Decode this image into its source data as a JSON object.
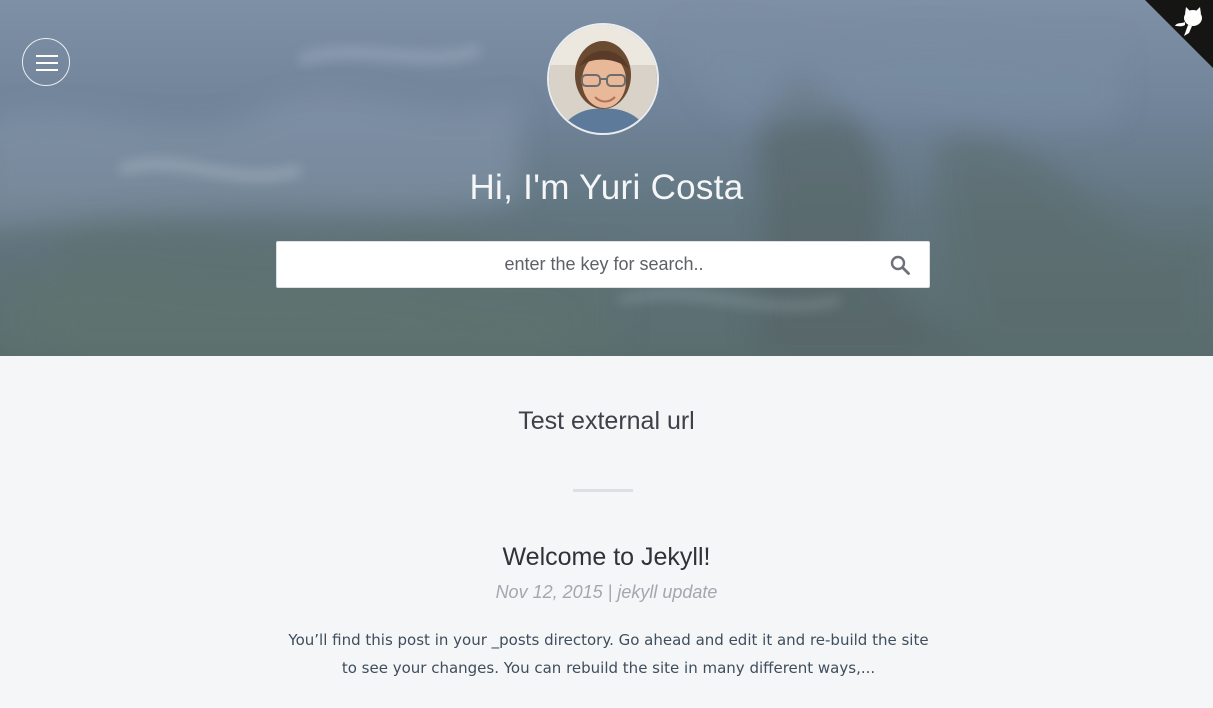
{
  "header": {
    "title": "Hi, I'm Yuri Costa",
    "search": {
      "placeholder": "enter the key for search..",
      "value": ""
    }
  },
  "icons": {
    "menu": "hamburger-menu-icon",
    "search": "search-icon",
    "corner": "github-octocat-icon",
    "avatar": "profile-photo"
  },
  "main": {
    "section_title": "Test external url",
    "posts": [
      {
        "title": "Welcome to Jekyll!",
        "date": "Nov 12, 2015",
        "separator": "|",
        "category": "jekyll update",
        "excerpt": "You’ll find this post in your _posts directory. Go ahead and edit it and re-build the site to see your changes. You can rebuild the site in many different ways,..."
      }
    ]
  },
  "colors": {
    "hero_top": "#7e90a6",
    "hero_bottom": "#5a6d6e",
    "page_bg": "#f5f6f8",
    "text_dark": "#2f3338",
    "meta_gray": "#a3a8ae"
  }
}
